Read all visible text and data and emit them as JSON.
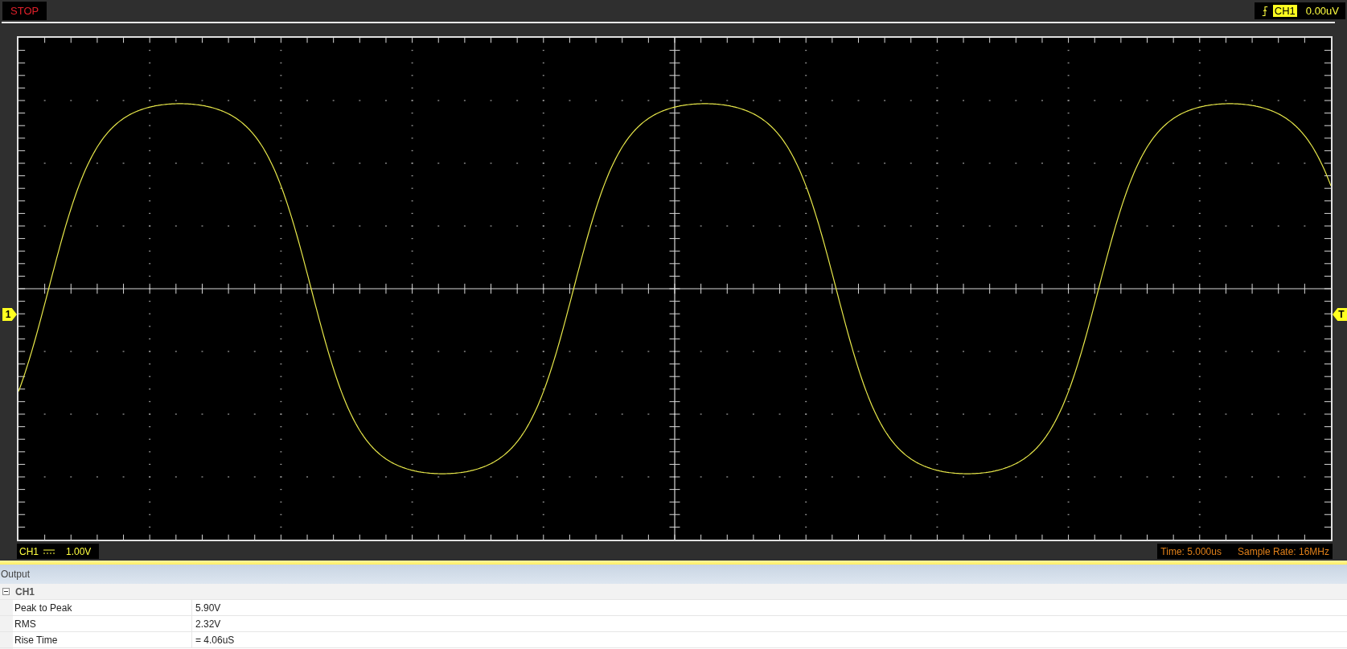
{
  "top_bar": {
    "run_state": "STOP",
    "trigger": {
      "channel": "CH1",
      "level": "0.00uV"
    }
  },
  "screen": {
    "channel_marker": "1",
    "trigger_marker": "T"
  },
  "bottom_bar": {
    "channel": "CH1",
    "volts_per_div": "1.00V",
    "time_per_div": "Time: 5.000us",
    "sample_rate": "Sample Rate: 16MHz"
  },
  "output": {
    "title": "Output",
    "groups": [
      {
        "name": "CH1",
        "expanded": true,
        "rows": [
          {
            "label": "Peak to Peak",
            "value": "5.90V"
          },
          {
            "label": "RMS",
            "value": "2.32V"
          },
          {
            "label": "Rise Time",
            "value": "= 4.06uS"
          }
        ]
      }
    ]
  }
}
